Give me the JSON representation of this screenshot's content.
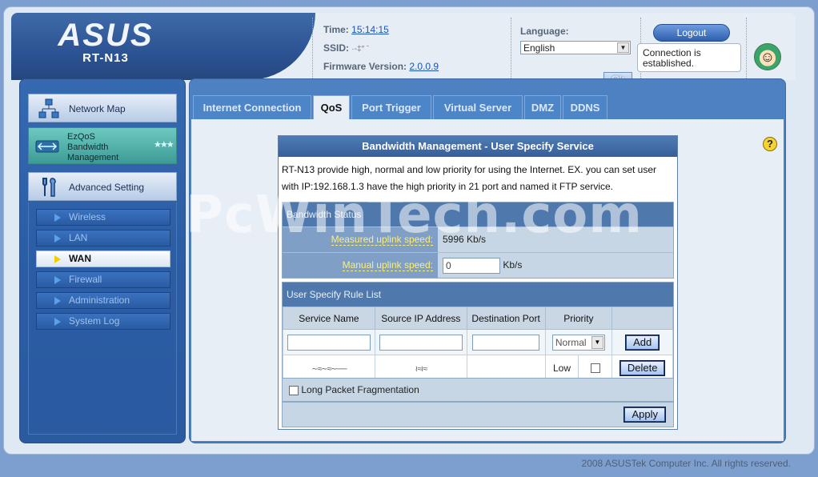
{
  "header": {
    "logo": "ASUS",
    "model": "RT-N13",
    "time_label": "Time:",
    "time_value": "15:14:15",
    "ssid_label": "SSID:",
    "ssid_value": "·‐‡″ ˉ",
    "firmware_label": "Firmware Version:",
    "firmware_value": "2.0.0.9",
    "language_label": "Language:",
    "language_value": "English",
    "ok_label": "Ok",
    "logout_label": "Logout",
    "connection_status": "Connection is established."
  },
  "sidebar": {
    "main_items": [
      {
        "label": "Network Map",
        "icon": "network-map-icon"
      },
      {
        "label": "EzQoS Bandwidth Management",
        "icon": "ezqos-icon"
      },
      {
        "label": "Advanced Setting",
        "icon": "wrench-icon"
      }
    ],
    "ezqos_lines": [
      "EzQoS",
      "Bandwidth",
      "Management"
    ],
    "sub_items": [
      {
        "label": "Wireless",
        "active": false
      },
      {
        "label": "LAN",
        "active": false
      },
      {
        "label": "WAN",
        "active": true
      },
      {
        "label": "Firewall",
        "active": false
      },
      {
        "label": "Administration",
        "active": false
      },
      {
        "label": "System Log",
        "active": false
      }
    ]
  },
  "tabs": [
    {
      "label": "Internet Connection",
      "active": false
    },
    {
      "label": "QoS",
      "active": true
    },
    {
      "label": "Port Trigger",
      "active": false
    },
    {
      "label": "Virtual Server",
      "active": false
    },
    {
      "label": "DMZ",
      "active": false
    },
    {
      "label": "DDNS",
      "active": false
    }
  ],
  "card": {
    "title": "Bandwidth Management - User Specify Service",
    "description": "RT-N13 provide high, normal and low priority for using the Internet. EX. you can set user with IP:192.168.1.3 have the high priority in 21 port and named it FTP service.",
    "bandwidth_status": {
      "heading": "Bandwidth Status",
      "measured_label": "Measured uplink speed:",
      "measured_value": "5996 Kb/s",
      "manual_label": "Manual uplink speed:",
      "manual_value": "0",
      "manual_unit": "Kb/s"
    },
    "rule_list": {
      "heading": "User Specify Rule List",
      "columns": [
        "Service Name",
        "Source IP Address",
        "Destination Port",
        "Priority"
      ],
      "priority_default": "Normal",
      "add_label": "Add",
      "rows": [
        {
          "service": "∼≈∼≈∼──",
          "source_ip": "≀≈≀≈",
          "port": "",
          "priority": "Low",
          "delete_label": "Delete"
        }
      ]
    },
    "long_packet_label": "Long Packet Fragmentation",
    "apply_label": "Apply"
  },
  "watermark": "PcWinTech.com",
  "footer": "2008 ASUSTek Computer Inc. All rights reserved.",
  "colors": {
    "sidebar_blue": "#2b5da5",
    "header_blue": "#2c5393",
    "tab_blue": "#4d86c8",
    "label_yellow": "#fbef7a"
  }
}
